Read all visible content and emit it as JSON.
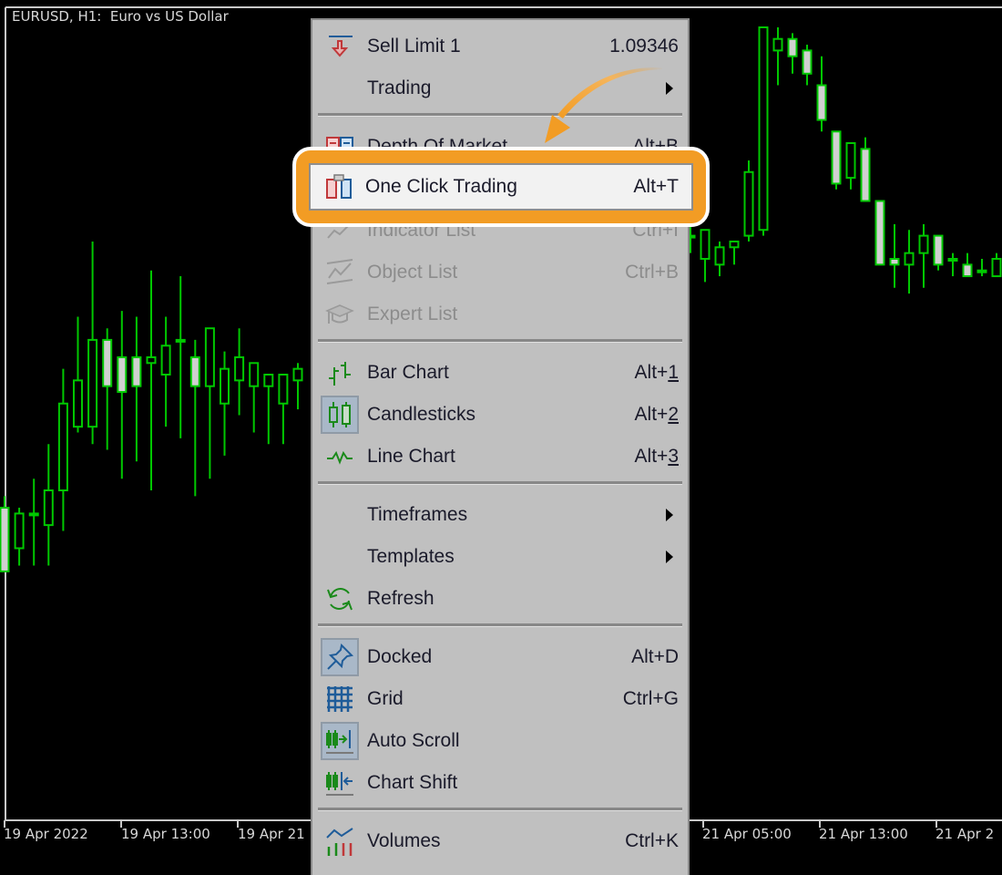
{
  "chart": {
    "title": "EURUSD, H1:  Euro vs US Dollar",
    "symbol": "EURUSD",
    "timeframe": "H1",
    "description": "Euro vs US Dollar",
    "colors": {
      "background": "#000000",
      "candle_line": "#00c800",
      "bull_fill": "#000000",
      "bear_fill": "#d0d0d0",
      "axis": "#c8c8c8",
      "text": "#d8d8d8"
    },
    "time_axis": [
      "19 Apr 2022",
      "19 Apr 13:00",
      "19 Apr 21",
      "21 Apr 05:00",
      "21 Apr 13:00",
      "21 Apr 2"
    ]
  },
  "chart_data": {
    "type": "candlestick",
    "title": "EURUSD, H1:  Euro vs US Dollar",
    "xlabel": "",
    "ylabel": "",
    "x_ticks": [
      "19 Apr 2022",
      "19 Apr 13:00",
      "19 Apr 21",
      "21 Apr 05:00",
      "21 Apr 13:00",
      "21 Apr 2"
    ],
    "note": "values are relative price levels read from screen (0 = lowest visible, 100 = highest visible)",
    "left_segment": [
      {
        "o": 17,
        "h": 19,
        "l": 6,
        "c": 6
      },
      {
        "o": 10,
        "h": 17,
        "l": 7,
        "c": 16
      },
      {
        "o": 16,
        "h": 22,
        "l": 7,
        "c": 16
      },
      {
        "o": 14,
        "h": 28,
        "l": 7,
        "c": 20
      },
      {
        "o": 20,
        "h": 41,
        "l": 13,
        "c": 35
      },
      {
        "o": 31,
        "h": 50,
        "l": 30,
        "c": 39
      },
      {
        "o": 31,
        "h": 63,
        "l": 28,
        "c": 46
      },
      {
        "o": 46,
        "h": 48,
        "l": 27,
        "c": 38
      },
      {
        "o": 43,
        "h": 51,
        "l": 22,
        "c": 37
      },
      {
        "o": 43,
        "h": 50,
        "l": 25,
        "c": 38
      },
      {
        "o": 42,
        "h": 58,
        "l": 20,
        "c": 43
      },
      {
        "o": 40,
        "h": 50,
        "l": 31,
        "c": 45
      },
      {
        "o": 46,
        "h": 57,
        "l": 29,
        "c": 46
      },
      {
        "o": 43,
        "h": 46,
        "l": 19,
        "c": 38
      },
      {
        "o": 38,
        "h": 43,
        "l": 22,
        "c": 48
      },
      {
        "o": 35,
        "h": 44,
        "l": 26,
        "c": 41
      },
      {
        "o": 39,
        "h": 48,
        "l": 33,
        "c": 43
      },
      {
        "o": 38,
        "h": 40,
        "l": 30,
        "c": 42
      },
      {
        "o": 38,
        "h": 37,
        "l": 28,
        "c": 40
      },
      {
        "o": 35,
        "h": 40,
        "l": 28,
        "c": 40
      },
      {
        "o": 39,
        "h": 42,
        "l": 34,
        "c": 41
      }
    ],
    "right_segment": [
      {
        "o": 64,
        "h": 66,
        "l": 61,
        "c": 64
      },
      {
        "o": 60,
        "h": 64,
        "l": 56,
        "c": 65
      },
      {
        "o": 59,
        "h": 63,
        "l": 57,
        "c": 62
      },
      {
        "o": 62,
        "h": 63,
        "l": 59,
        "c": 63
      },
      {
        "o": 64,
        "h": 77,
        "l": 63,
        "c": 75
      },
      {
        "o": 65,
        "h": 99,
        "l": 64,
        "c": 100
      },
      {
        "o": 96,
        "h": 100,
        "l": 90,
        "c": 98
      },
      {
        "o": 98,
        "h": 99,
        "l": 92,
        "c": 95
      },
      {
        "o": 96,
        "h": 97,
        "l": 90,
        "c": 92
      },
      {
        "o": 90,
        "h": 95,
        "l": 82,
        "c": 84
      },
      {
        "o": 82,
        "h": 82,
        "l": 72,
        "c": 73
      },
      {
        "o": 74,
        "h": 80,
        "l": 72,
        "c": 80
      },
      {
        "o": 79,
        "h": 81,
        "l": 70,
        "c": 70
      },
      {
        "o": 70,
        "h": 70,
        "l": 59,
        "c": 59
      },
      {
        "o": 60,
        "h": 66,
        "l": 55,
        "c": 59
      },
      {
        "o": 59,
        "h": 65,
        "l": 54,
        "c": 61
      },
      {
        "o": 61,
        "h": 66,
        "l": 55,
        "c": 64
      },
      {
        "o": 64,
        "h": 64,
        "l": 58,
        "c": 59
      },
      {
        "o": 60,
        "h": 61,
        "l": 57,
        "c": 60
      },
      {
        "o": 59,
        "h": 61,
        "l": 57,
        "c": 57
      },
      {
        "o": 58,
        "h": 60,
        "l": 57,
        "c": 58
      },
      {
        "o": 57,
        "h": 61,
        "l": 57,
        "c": 60
      }
    ]
  },
  "context_menu": {
    "items": [
      {
        "id": "sell-limit",
        "label": "Sell Limit 1",
        "shortcut": "1.09346",
        "icon": "sell-limit-icon",
        "type": "item"
      },
      {
        "id": "trading",
        "label": "Trading",
        "shortcut": "",
        "icon": "",
        "type": "submenu"
      },
      {
        "type": "separator"
      },
      {
        "id": "depth-of-market",
        "label": "Depth Of Market",
        "shortcut": "Alt+B",
        "icon": "depth-of-market-icon",
        "type": "item"
      },
      {
        "id": "one-click-trading",
        "label": "One Click Trading",
        "shortcut": "Alt+T",
        "icon": "one-click-trading-icon",
        "type": "item",
        "highlighted": true
      },
      {
        "id": "indicator-list",
        "label": "Indicator List",
        "shortcut": "Ctrl+I",
        "icon": "indicator-list-icon",
        "type": "item",
        "disabled": true
      },
      {
        "id": "object-list",
        "label": "Object List",
        "shortcut": "Ctrl+B",
        "icon": "object-list-icon",
        "type": "item",
        "disabled": true
      },
      {
        "id": "expert-list",
        "label": "Expert List",
        "shortcut": "",
        "icon": "expert-list-icon",
        "type": "item",
        "disabled": true
      },
      {
        "type": "separator"
      },
      {
        "id": "bar-chart",
        "label": "Bar Chart",
        "shortcut_prefix": "Alt+",
        "shortcut_key": "1",
        "icon": "bar-chart-icon",
        "type": "item"
      },
      {
        "id": "candlesticks",
        "label": "Candlesticks",
        "shortcut_prefix": "Alt+",
        "shortcut_key": "2",
        "icon": "candlesticks-icon",
        "type": "item",
        "checked": true
      },
      {
        "id": "line-chart",
        "label": "Line Chart",
        "shortcut_prefix": "Alt+",
        "shortcut_key": "3",
        "icon": "line-chart-icon",
        "type": "item"
      },
      {
        "type": "separator"
      },
      {
        "id": "timeframes",
        "label": "Timeframes",
        "type": "submenu"
      },
      {
        "id": "templates",
        "label": "Templates",
        "type": "submenu"
      },
      {
        "id": "refresh",
        "label": "Refresh",
        "shortcut": "",
        "icon": "refresh-icon",
        "type": "item"
      },
      {
        "type": "separator"
      },
      {
        "id": "docked",
        "label": "Docked",
        "shortcut": "Alt+D",
        "icon": "docked-pin-icon",
        "type": "item",
        "checked": true
      },
      {
        "id": "grid",
        "label": "Grid",
        "shortcut": "Ctrl+G",
        "icon": "grid-icon",
        "type": "item"
      },
      {
        "id": "auto-scroll",
        "label": "Auto Scroll",
        "shortcut": "",
        "icon": "auto-scroll-icon",
        "type": "item",
        "checked": true
      },
      {
        "id": "chart-shift",
        "label": "Chart Shift",
        "shortcut": "",
        "icon": "chart-shift-icon",
        "type": "item"
      },
      {
        "type": "separator"
      },
      {
        "id": "volumes",
        "label": "Volumes",
        "shortcut": "Ctrl+K",
        "icon": "volumes-icon",
        "type": "item"
      }
    ],
    "labels": {
      "sell_limit": "Sell Limit 1",
      "sell_limit_price": "1.09346",
      "trading": "Trading",
      "depth_of_market": "Depth Of Market",
      "depth_of_market_sc": "Alt+B",
      "one_click_trading": "One Click Trading",
      "one_click_trading_sc": "Alt+T",
      "indicator_list": "Indicator List",
      "indicator_list_sc": "Ctrl+I",
      "object_list": "Object List",
      "object_list_sc": "Ctrl+B",
      "expert_list": "Expert List",
      "bar_chart": "Bar Chart",
      "candlesticks": "Candlesticks",
      "line_chart": "Line Chart",
      "alt_prefix": "Alt+",
      "key_1": "1",
      "key_2": "2",
      "key_3": "3",
      "timeframes": "Timeframes",
      "templates": "Templates",
      "refresh": "Refresh",
      "docked": "Docked",
      "docked_sc": "Alt+D",
      "grid": "Grid",
      "grid_sc": "Ctrl+G",
      "auto_scroll": "Auto Scroll",
      "chart_shift": "Chart Shift",
      "volumes": "Volumes",
      "volumes_sc": "Ctrl+K"
    }
  },
  "annotation": {
    "highlight_color": "#f29c24",
    "target": "One Click Trading"
  }
}
